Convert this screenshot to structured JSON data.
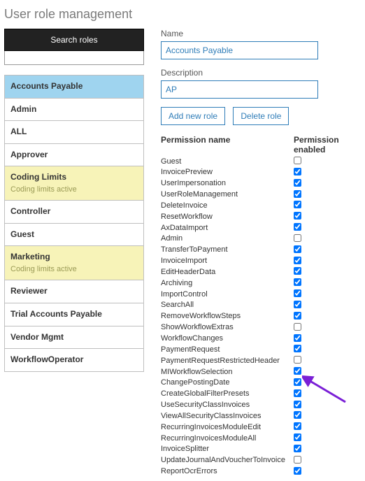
{
  "title": "User role management",
  "search_label": "Search roles",
  "roles": [
    {
      "name": "Accounts Payable",
      "selected": true
    },
    {
      "name": "Admin"
    },
    {
      "name": "ALL"
    },
    {
      "name": "Approver"
    },
    {
      "name": "Coding Limits",
      "sub": "Coding limits active",
      "limits": true
    },
    {
      "name": "Controller"
    },
    {
      "name": "Guest"
    },
    {
      "name": "Marketing",
      "sub": "Coding limits active",
      "limits": true
    },
    {
      "name": "Reviewer"
    },
    {
      "name": "Trial Accounts Payable"
    },
    {
      "name": "Vendor Mgmt"
    },
    {
      "name": "WorkflowOperator"
    }
  ],
  "form": {
    "name_label": "Name",
    "name_value": "Accounts Payable",
    "desc_label": "Description",
    "desc_value": "AP",
    "add_label": "Add new role",
    "delete_label": "Delete role"
  },
  "perm_header": {
    "name": "Permission name",
    "enabled": "Permission enabled"
  },
  "permissions": [
    {
      "name": "Guest",
      "enabled": false
    },
    {
      "name": "InvoicePreview",
      "enabled": true
    },
    {
      "name": "UserImpersonation",
      "enabled": true
    },
    {
      "name": "UserRoleManagement",
      "enabled": true
    },
    {
      "name": "DeleteInvoice",
      "enabled": true
    },
    {
      "name": "ResetWorkflow",
      "enabled": true
    },
    {
      "name": "AxDataImport",
      "enabled": true
    },
    {
      "name": "Admin",
      "enabled": false
    },
    {
      "name": "TransferToPayment",
      "enabled": true
    },
    {
      "name": "InvoiceImport",
      "enabled": true
    },
    {
      "name": "EditHeaderData",
      "enabled": true
    },
    {
      "name": "Archiving",
      "enabled": true
    },
    {
      "name": "ImportControl",
      "enabled": true
    },
    {
      "name": "SearchAll",
      "enabled": true
    },
    {
      "name": "RemoveWorkflowSteps",
      "enabled": true
    },
    {
      "name": "ShowWorkflowExtras",
      "enabled": false
    },
    {
      "name": "WorkflowChanges",
      "enabled": true
    },
    {
      "name": "PaymentRequest",
      "enabled": true
    },
    {
      "name": "PaymentRequestRestrictedHeader",
      "enabled": false
    },
    {
      "name": "MIWorkflowSelection",
      "enabled": true
    },
    {
      "name": "ChangePostingDate",
      "enabled": true
    },
    {
      "name": "CreateGlobalFilterPresets",
      "enabled": true
    },
    {
      "name": "UseSecurityClassInvoices",
      "enabled": true
    },
    {
      "name": "ViewAllSecurityClassInvoices",
      "enabled": true
    },
    {
      "name": "RecurringInvoicesModuleEdit",
      "enabled": true
    },
    {
      "name": "RecurringInvoicesModuleAll",
      "enabled": true
    },
    {
      "name": "InvoiceSplitter",
      "enabled": true
    },
    {
      "name": "UpdateJournalAndVoucherToInvoice",
      "enabled": false
    },
    {
      "name": "ReportOcrErrors",
      "enabled": true
    }
  ]
}
